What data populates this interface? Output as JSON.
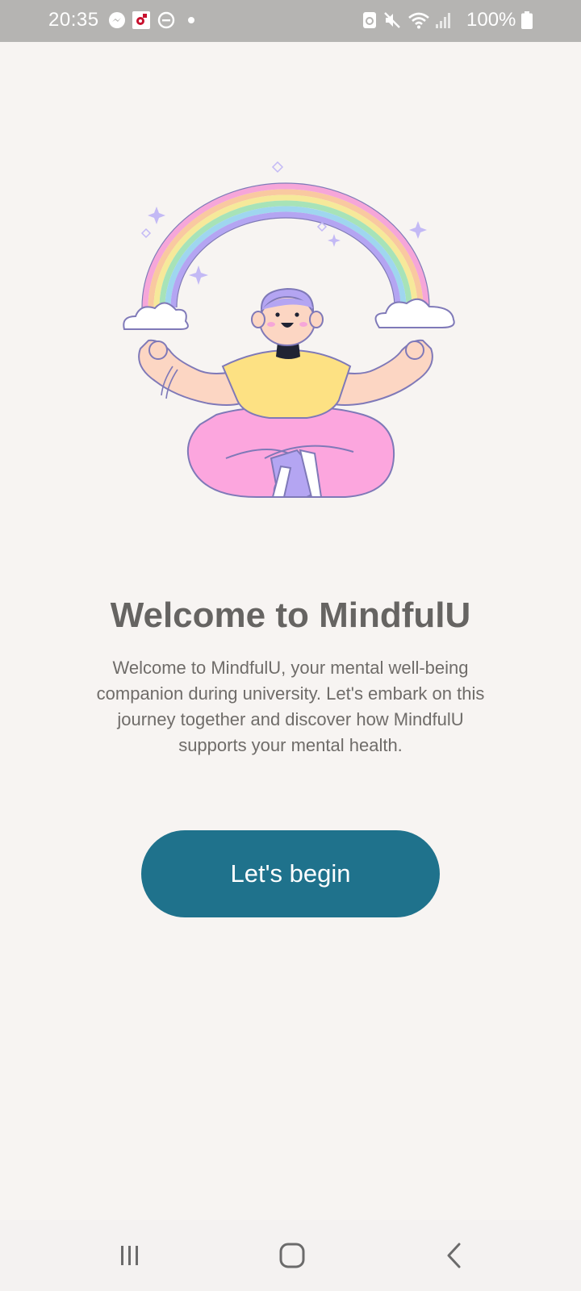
{
  "status_bar": {
    "time": "20:35",
    "battery_percent": "100%",
    "left_icons": [
      "messenger-icon",
      "app-notification-icon",
      "do-not-disturb-icon",
      "dot-icon"
    ],
    "right_icons": [
      "nfc-icon",
      "mute-icon",
      "wifi-icon",
      "signal-icon",
      "battery-icon"
    ]
  },
  "welcome": {
    "title": "Welcome to MindfulU",
    "description": "Welcome to MindfulU, your mental well-being companion during university. Let's embark on this journey together and discover how MindfulU supports your mental health.",
    "button_label": "Let's begin"
  },
  "nav_bar": {
    "icons": [
      "recent-apps-icon",
      "home-icon",
      "back-icon"
    ]
  },
  "colors": {
    "background": "#f7f4f2",
    "button": "#1f728c",
    "title": "#666462",
    "body_text": "#6f6c69",
    "status_bar": "#b5b4b2"
  }
}
